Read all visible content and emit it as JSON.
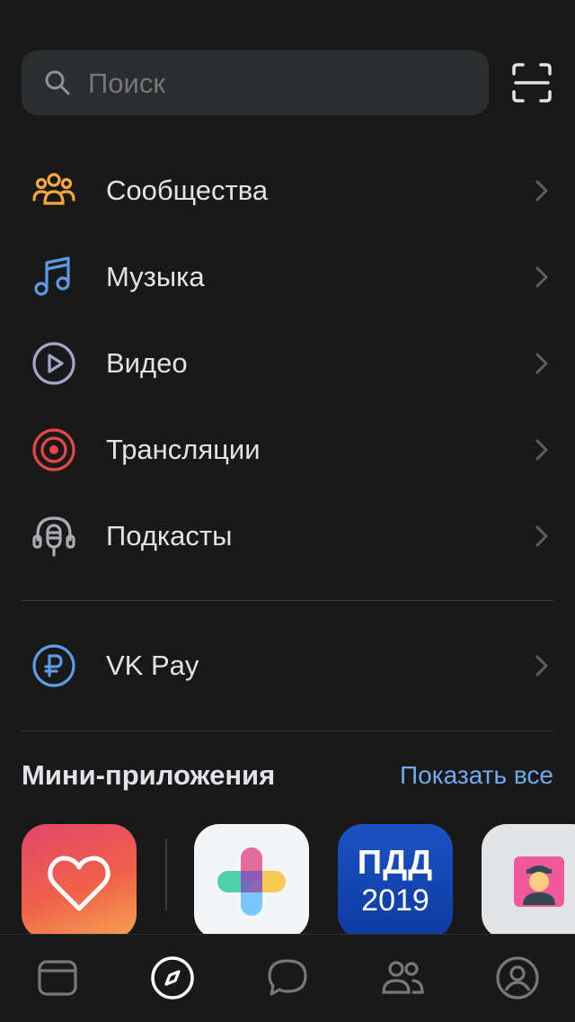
{
  "search": {
    "placeholder": "Поиск"
  },
  "icons": {
    "search": "search-icon",
    "scan": "qr-scan-icon",
    "chevron": "chevron-right-icon"
  },
  "menu": [
    {
      "label": "Сообщества",
      "icon": "communities-icon",
      "color": "#f5a93b"
    },
    {
      "label": "Музыка",
      "icon": "music-note-icon",
      "color": "#5c9ce6"
    },
    {
      "label": "Видео",
      "icon": "video-play-icon",
      "color": "#a4a6c8"
    },
    {
      "label": "Трансляции",
      "icon": "live-broadcast-icon",
      "color": "#e64646"
    },
    {
      "label": "Подкасты",
      "icon": "podcast-mic-icon",
      "color": "#aaaeb3"
    }
  ],
  "vkpay": {
    "label": "VK Pay",
    "icon": "ruble-icon",
    "color": "#5c9ce6"
  },
  "mini_apps": {
    "title": "Мини-приложения",
    "show_all": "Показать все",
    "apps": [
      {
        "icon": "heart-icon"
      },
      {
        "icon": "plus-colorful-icon"
      },
      {
        "top": "ПДД",
        "bottom": "2019"
      },
      {
        "icon": "pilot-emoji-icon"
      }
    ]
  },
  "tabbar": {
    "items": [
      {
        "icon": "news-feed-icon",
        "active": false
      },
      {
        "icon": "discover-compass-icon",
        "active": true
      },
      {
        "icon": "messages-bubble-icon",
        "active": false
      },
      {
        "icon": "friends-icon",
        "active": false
      },
      {
        "icon": "profile-icon",
        "active": false
      }
    ]
  },
  "colors": {
    "background": "#19191a",
    "surface": "#2c2d2e",
    "text": "#e1e3e6",
    "secondary": "#76787a",
    "accent": "#71aaeb"
  }
}
